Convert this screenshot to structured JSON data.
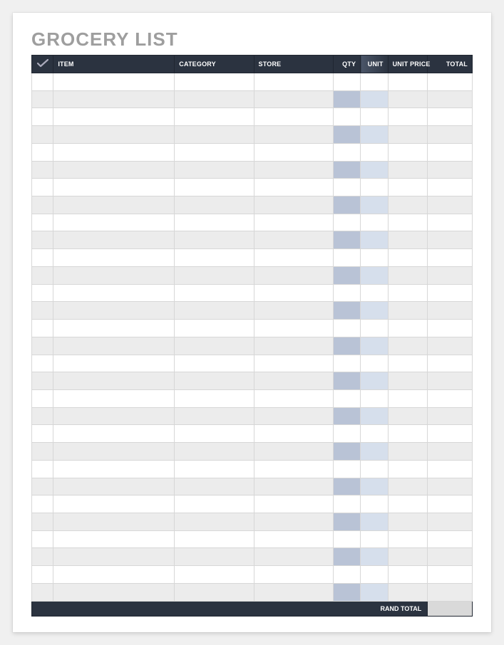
{
  "title": "GROCERY LIST",
  "columns": {
    "check": "",
    "item": "ITEM",
    "category": "CATEGORY",
    "store": "STORE",
    "qty": "QTY",
    "unit": "UNIT",
    "unit_price": "UNIT PRICE",
    "total": "TOTAL"
  },
  "rows": [
    {
      "check": "",
      "item": "",
      "category": "",
      "store": "",
      "qty": "",
      "unit": "",
      "unit_price": "",
      "total": ""
    },
    {
      "check": "",
      "item": "",
      "category": "",
      "store": "",
      "qty": "",
      "unit": "",
      "unit_price": "",
      "total": ""
    },
    {
      "check": "",
      "item": "",
      "category": "",
      "store": "",
      "qty": "",
      "unit": "",
      "unit_price": "",
      "total": ""
    },
    {
      "check": "",
      "item": "",
      "category": "",
      "store": "",
      "qty": "",
      "unit": "",
      "unit_price": "",
      "total": ""
    },
    {
      "check": "",
      "item": "",
      "category": "",
      "store": "",
      "qty": "",
      "unit": "",
      "unit_price": "",
      "total": ""
    },
    {
      "check": "",
      "item": "",
      "category": "",
      "store": "",
      "qty": "",
      "unit": "",
      "unit_price": "",
      "total": ""
    },
    {
      "check": "",
      "item": "",
      "category": "",
      "store": "",
      "qty": "",
      "unit": "",
      "unit_price": "",
      "total": ""
    },
    {
      "check": "",
      "item": "",
      "category": "",
      "store": "",
      "qty": "",
      "unit": "",
      "unit_price": "",
      "total": ""
    },
    {
      "check": "",
      "item": "",
      "category": "",
      "store": "",
      "qty": "",
      "unit": "",
      "unit_price": "",
      "total": ""
    },
    {
      "check": "",
      "item": "",
      "category": "",
      "store": "",
      "qty": "",
      "unit": "",
      "unit_price": "",
      "total": ""
    },
    {
      "check": "",
      "item": "",
      "category": "",
      "store": "",
      "qty": "",
      "unit": "",
      "unit_price": "",
      "total": ""
    },
    {
      "check": "",
      "item": "",
      "category": "",
      "store": "",
      "qty": "",
      "unit": "",
      "unit_price": "",
      "total": ""
    },
    {
      "check": "",
      "item": "",
      "category": "",
      "store": "",
      "qty": "",
      "unit": "",
      "unit_price": "",
      "total": ""
    },
    {
      "check": "",
      "item": "",
      "category": "",
      "store": "",
      "qty": "",
      "unit": "",
      "unit_price": "",
      "total": ""
    },
    {
      "check": "",
      "item": "",
      "category": "",
      "store": "",
      "qty": "",
      "unit": "",
      "unit_price": "",
      "total": ""
    },
    {
      "check": "",
      "item": "",
      "category": "",
      "store": "",
      "qty": "",
      "unit": "",
      "unit_price": "",
      "total": ""
    },
    {
      "check": "",
      "item": "",
      "category": "",
      "store": "",
      "qty": "",
      "unit": "",
      "unit_price": "",
      "total": ""
    },
    {
      "check": "",
      "item": "",
      "category": "",
      "store": "",
      "qty": "",
      "unit": "",
      "unit_price": "",
      "total": ""
    },
    {
      "check": "",
      "item": "",
      "category": "",
      "store": "",
      "qty": "",
      "unit": "",
      "unit_price": "",
      "total": ""
    },
    {
      "check": "",
      "item": "",
      "category": "",
      "store": "",
      "qty": "",
      "unit": "",
      "unit_price": "",
      "total": ""
    },
    {
      "check": "",
      "item": "",
      "category": "",
      "store": "",
      "qty": "",
      "unit": "",
      "unit_price": "",
      "total": ""
    },
    {
      "check": "",
      "item": "",
      "category": "",
      "store": "",
      "qty": "",
      "unit": "",
      "unit_price": "",
      "total": ""
    },
    {
      "check": "",
      "item": "",
      "category": "",
      "store": "",
      "qty": "",
      "unit": "",
      "unit_price": "",
      "total": ""
    },
    {
      "check": "",
      "item": "",
      "category": "",
      "store": "",
      "qty": "",
      "unit": "",
      "unit_price": "",
      "total": ""
    },
    {
      "check": "",
      "item": "",
      "category": "",
      "store": "",
      "qty": "",
      "unit": "",
      "unit_price": "",
      "total": ""
    },
    {
      "check": "",
      "item": "",
      "category": "",
      "store": "",
      "qty": "",
      "unit": "",
      "unit_price": "",
      "total": ""
    },
    {
      "check": "",
      "item": "",
      "category": "",
      "store": "",
      "qty": "",
      "unit": "",
      "unit_price": "",
      "total": ""
    },
    {
      "check": "",
      "item": "",
      "category": "",
      "store": "",
      "qty": "",
      "unit": "",
      "unit_price": "",
      "total": ""
    },
    {
      "check": "",
      "item": "",
      "category": "",
      "store": "",
      "qty": "",
      "unit": "",
      "unit_price": "",
      "total": ""
    },
    {
      "check": "",
      "item": "",
      "category": "",
      "store": "",
      "qty": "",
      "unit": "",
      "unit_price": "",
      "total": ""
    }
  ],
  "footer": {
    "label": "RAND TOTAL",
    "value": ""
  }
}
